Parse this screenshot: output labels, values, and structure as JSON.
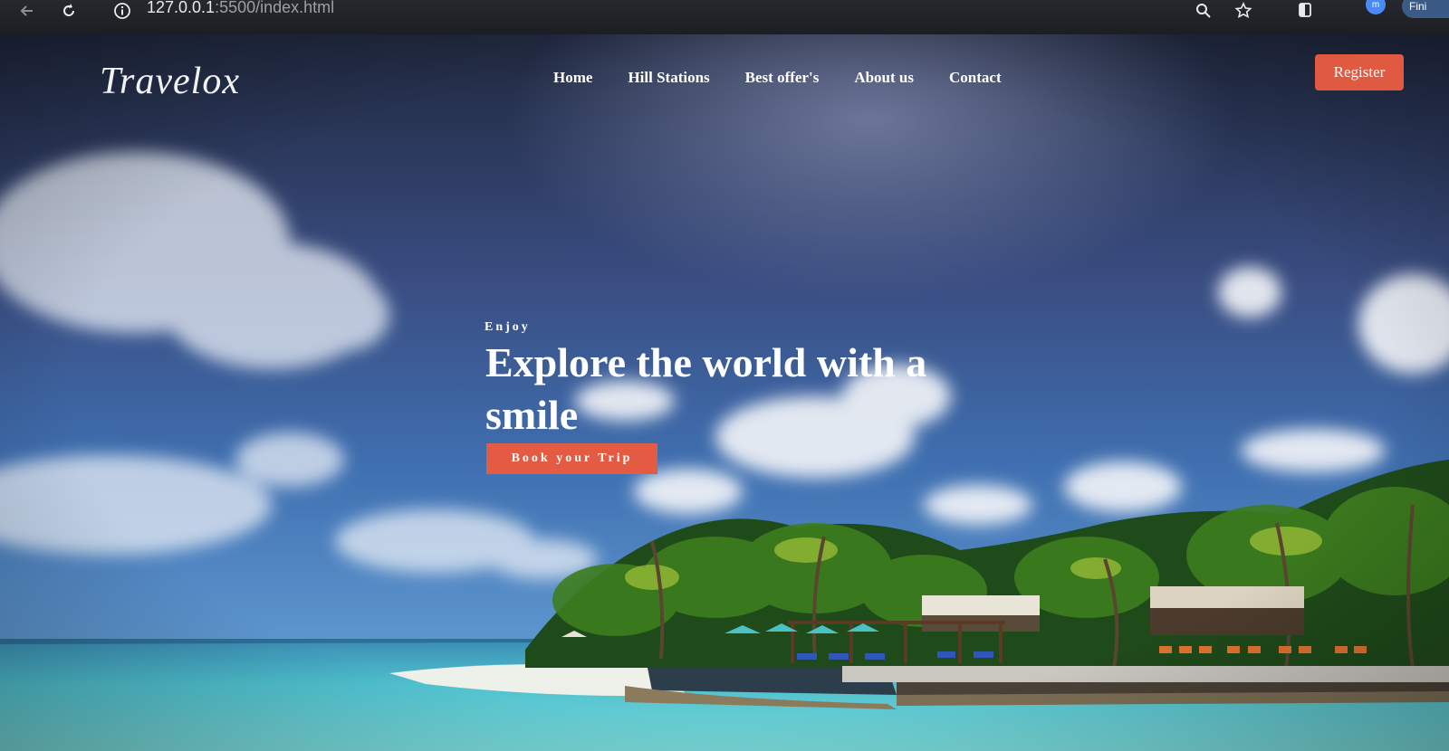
{
  "browser": {
    "url_host": "127.0.0.1",
    "url_path": ":5500/index.html",
    "profile_chip": "Fini"
  },
  "site": {
    "logo": "Travelox",
    "nav": [
      "Home",
      "Hill Stations",
      "Best offer's",
      "About us",
      "Contact"
    ],
    "register_label": "Register"
  },
  "hero": {
    "eyebrow": "Enjoy",
    "headline": "Explore the world with a smile",
    "cta_label": "Book your Trip"
  },
  "colors": {
    "accent": "#e45b43",
    "text_light": "#ffffff"
  },
  "icons": [
    "back-icon",
    "reload-icon",
    "info-icon",
    "zoom-icon",
    "bookmark-star-icon",
    "extensions-icon"
  ]
}
